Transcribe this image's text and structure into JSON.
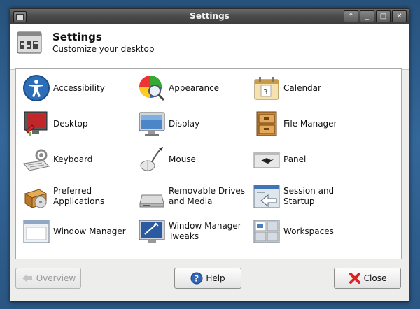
{
  "window": {
    "title": "Settings",
    "controls": [
      "↑",
      "_",
      "□",
      "✕"
    ]
  },
  "header": {
    "title": "Settings",
    "subtitle": "Customize your desktop"
  },
  "items": [
    {
      "label": "Accessibility",
      "icon": "accessibility-icon"
    },
    {
      "label": "Appearance",
      "icon": "appearance-icon"
    },
    {
      "label": "Calendar",
      "icon": "calendar-icon"
    },
    {
      "label": "Desktop",
      "icon": "desktop-icon"
    },
    {
      "label": "Display",
      "icon": "display-icon"
    },
    {
      "label": "File Manager",
      "icon": "file-manager-icon"
    },
    {
      "label": "Keyboard",
      "icon": "keyboard-icon"
    },
    {
      "label": "Mouse",
      "icon": "mouse-icon"
    },
    {
      "label": "Panel",
      "icon": "panel-icon"
    },
    {
      "label": "Preferred\nApplications",
      "icon": "preferred-applications-icon"
    },
    {
      "label": "Removable Drives\nand Media",
      "icon": "removable-drives-icon"
    },
    {
      "label": "Session and\nStartup",
      "icon": "session-startup-icon"
    },
    {
      "label": "Window Manager",
      "icon": "window-manager-icon"
    },
    {
      "label": "Window Manager\nTweaks",
      "icon": "window-manager-tweaks-icon"
    },
    {
      "label": "Workspaces",
      "icon": "workspaces-icon"
    }
  ],
  "buttons": {
    "overview": {
      "underlined": "O",
      "rest": "verview",
      "enabled": false
    },
    "help": {
      "underlined": "H",
      "rest": "elp"
    },
    "close": {
      "underlined": "C",
      "rest": "lose"
    }
  }
}
